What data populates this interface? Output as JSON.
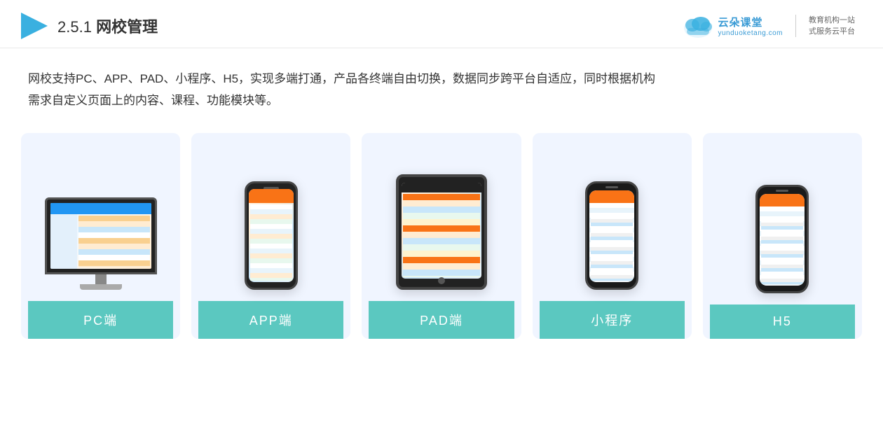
{
  "header": {
    "section_number": "2.5.1",
    "title": "网校管理",
    "logo": {
      "name": "云朵课堂",
      "url": "yunduoketang.com",
      "slogan_line1": "教育机构一站",
      "slogan_line2": "式服务云平台"
    }
  },
  "description": {
    "text_line1": "网校支持PC、APP、PAD、小程序、H5，实现多端打通，产品各终端自由切换，数据同步跨平台自适应，同时根据机构",
    "text_line2": "需求自定义页面上的内容、课程、功能模块等。"
  },
  "cards": [
    {
      "id": "pc",
      "label": "PC端"
    },
    {
      "id": "app",
      "label": "APP端"
    },
    {
      "id": "pad",
      "label": "PAD端"
    },
    {
      "id": "miniapp",
      "label": "小程序"
    },
    {
      "id": "h5",
      "label": "H5"
    }
  ]
}
